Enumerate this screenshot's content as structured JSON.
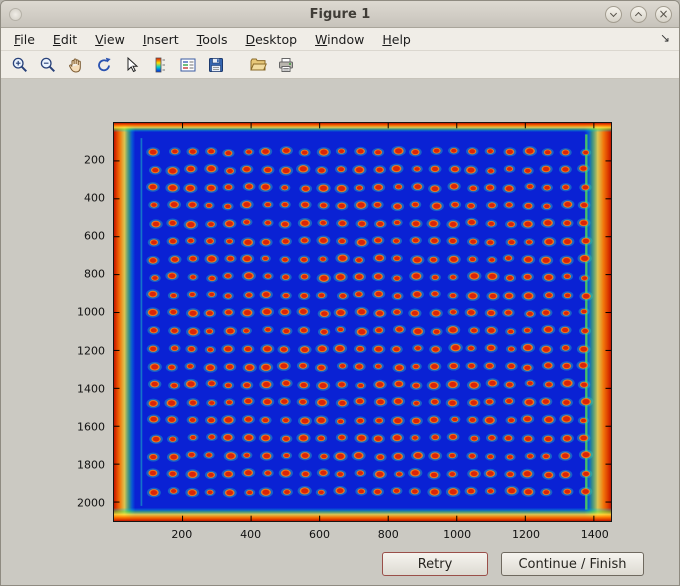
{
  "window": {
    "title": "Figure 1",
    "close_glyph": "×",
    "controls": [
      "window-menu",
      "minimize",
      "maximize",
      "close"
    ]
  },
  "menu": {
    "items": [
      "File",
      "Edit",
      "View",
      "Insert",
      "Tools",
      "Desktop",
      "Window",
      "Help"
    ],
    "dock_glyph": "↘"
  },
  "toolbar": {
    "icons": [
      "zoom-in",
      "zoom-out",
      "pan",
      "rotate-3d",
      "data-cursor",
      "insert-colorbar",
      "insert-legend",
      "save-figure",
      "open-file",
      "print-figure"
    ]
  },
  "figure": {
    "retry_label": "Retry",
    "continue_label": "Continue / Finish",
    "background_color": "#cbc9c2"
  },
  "chart_data": {
    "type": "heatmap",
    "title": "",
    "xlabel": "",
    "ylabel": "",
    "description": "Scanned plate / dot-array image shown with jet colormap: regular grid of red-orange spots on a saturated blue background, with warm red/yellow/green edge artifacts around the borders",
    "x_range": [
      0,
      1450
    ],
    "y_range": [
      0,
      2100
    ],
    "x_ticks": [
      200,
      400,
      600,
      800,
      1000,
      1200,
      1400
    ],
    "y_ticks": [
      200,
      400,
      600,
      800,
      1000,
      1200,
      1400,
      1600,
      1800,
      2000
    ],
    "grid": {
      "rows": 20,
      "cols": 24,
      "x_start": 118,
      "x_step": 54.6,
      "y_start": 152,
      "y_step": 94.4,
      "dot_rx": 13,
      "dot_ry": 17
    },
    "colormap": "jet",
    "colors": {
      "background": "#0a22d4",
      "dot_core": "#da2408",
      "dot_mid": "#ff8718",
      "dot_ring": "#2fd8b4",
      "edge_outer": "#c41400",
      "edge_mid": "#ff7a00",
      "edge_inner": "#ffe23c",
      "edge_green": "#55e050",
      "edge_cyan": "#00c8d8"
    }
  }
}
